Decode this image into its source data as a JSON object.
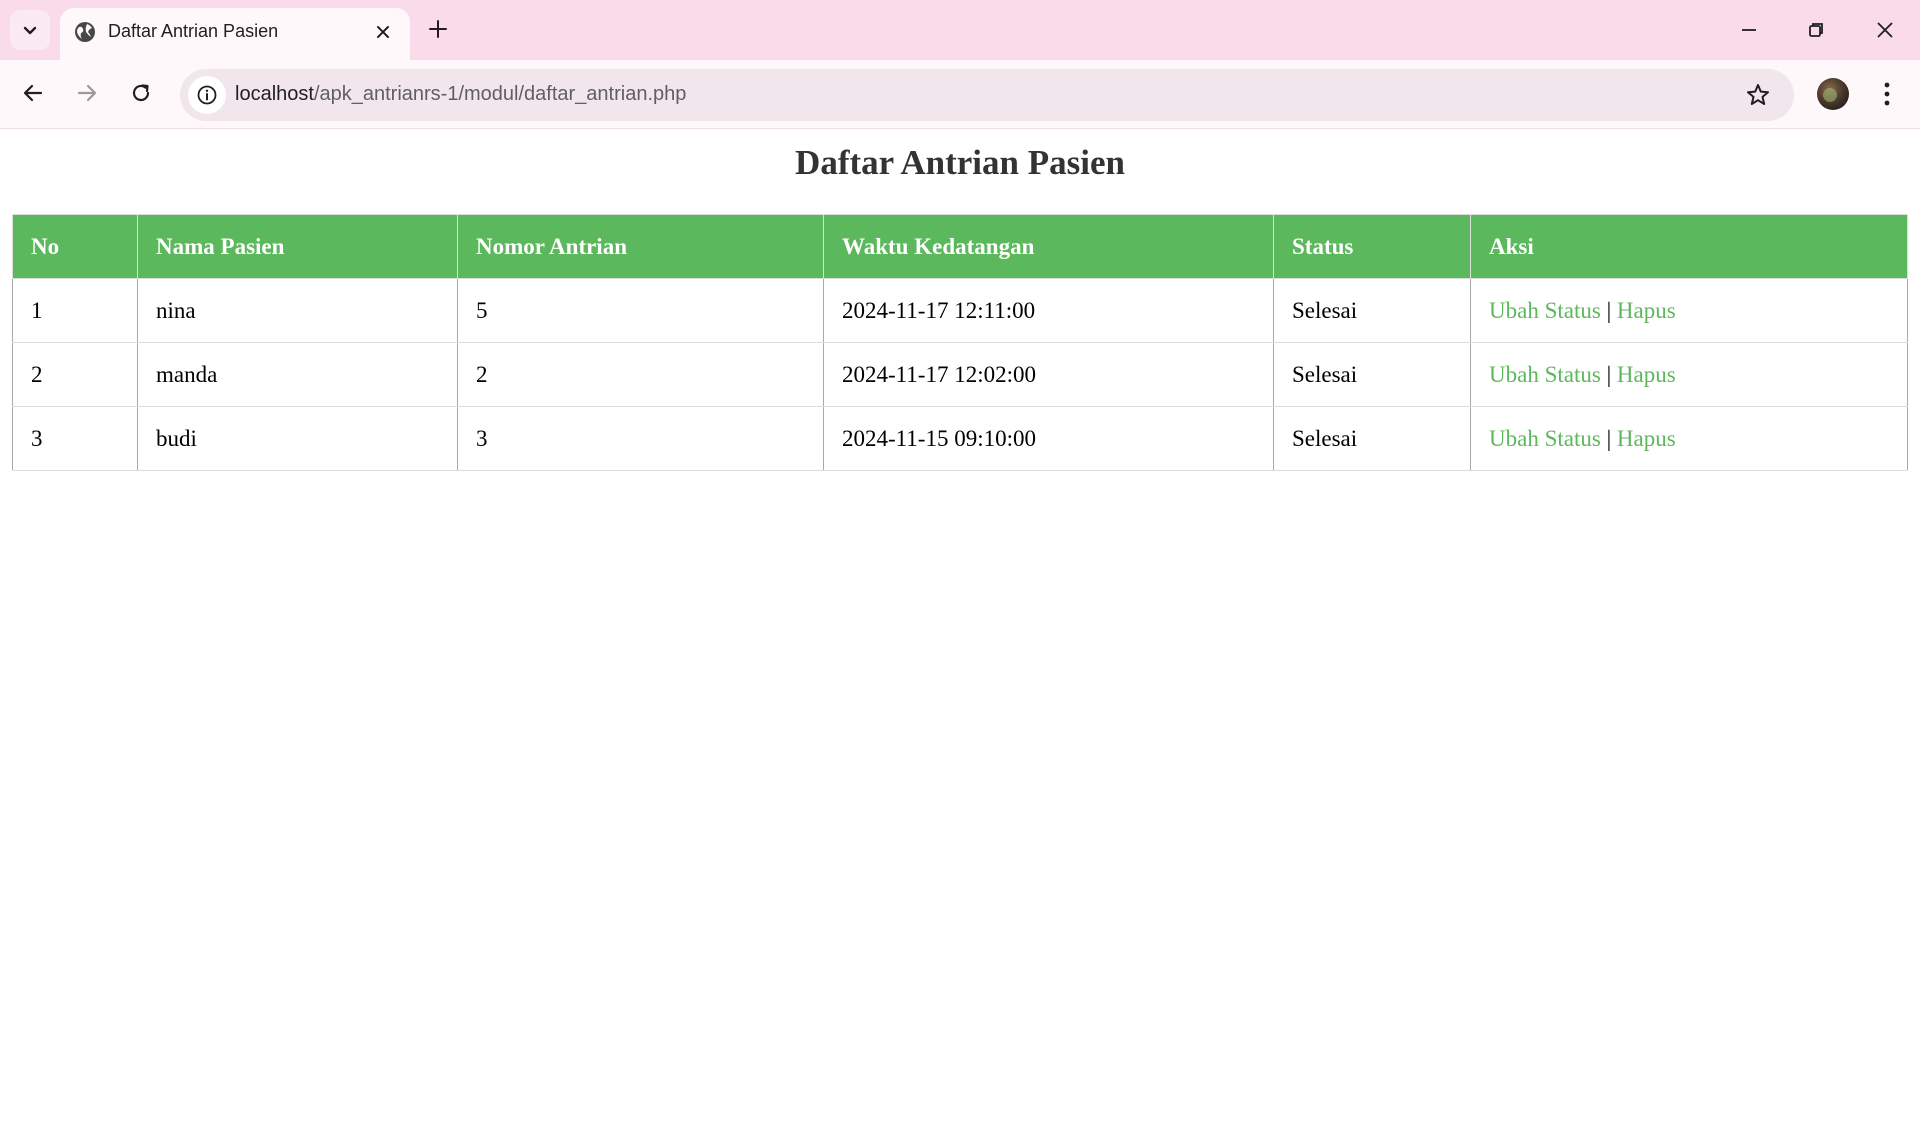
{
  "browser": {
    "tab_title": "Daftar Antrian Pasien",
    "url_host": "localhost",
    "url_path": "/apk_antrianrs-1/modul/daftar_antrian.php"
  },
  "page": {
    "title": "Daftar Antrian Pasien"
  },
  "table": {
    "headers": [
      "No",
      "Nama Pasien",
      "Nomor Antrian",
      "Waktu Kedatangan",
      "Status",
      "Aksi"
    ],
    "rows": [
      {
        "no": "1",
        "nama": "nina",
        "nomor": "5",
        "waktu": "2024-11-17 12:11:00",
        "status": "Selesai",
        "ubah": "Ubah Status",
        "sep": "|",
        "hapus": "Hapus"
      },
      {
        "no": "2",
        "nama": "manda",
        "nomor": "2",
        "waktu": "2024-11-17 12:02:00",
        "status": "Selesai",
        "ubah": "Ubah Status",
        "sep": "|",
        "hapus": "Hapus"
      },
      {
        "no": "3",
        "nama": "budi",
        "nomor": "3",
        "waktu": "2024-11-15 09:10:00",
        "status": "Selesai",
        "ubah": "Ubah Status",
        "sep": "|",
        "hapus": "Hapus"
      }
    ]
  },
  "colors": {
    "header_bg": "#5cb85c",
    "link": "#5cb85c",
    "tabbar_bg": "#f9dbe9"
  },
  "icons": {
    "tab_menu": "chevron-down-icon",
    "favicon": "globe-icon",
    "tab_close": "close-icon",
    "new_tab": "plus-icon",
    "back": "arrow-left-icon",
    "forward": "arrow-right-icon",
    "reload": "reload-icon",
    "site_info": "info-icon",
    "bookmark": "star-icon",
    "profile": "avatar",
    "menu": "more-vert-icon",
    "minimize": "minimize-icon",
    "restore": "restore-icon",
    "close_window": "close-window-icon"
  }
}
